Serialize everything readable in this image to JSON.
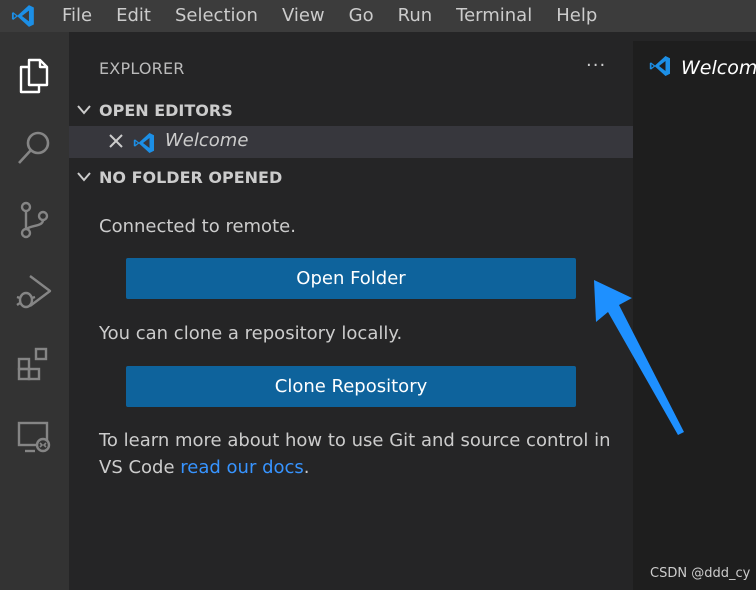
{
  "menubar": {
    "items": [
      "File",
      "Edit",
      "Selection",
      "View",
      "Go",
      "Run",
      "Terminal",
      "Help"
    ]
  },
  "activity_bar": {
    "icons": [
      "explorer-icon",
      "search-icon",
      "source-control-icon",
      "run-debug-icon",
      "extensions-icon",
      "remote-explorer-icon"
    ]
  },
  "sidebar": {
    "title": "EXPLORER",
    "more_actions": "···",
    "open_editors": {
      "header": "OPEN EDITORS",
      "items": [
        {
          "label": "Welcome"
        }
      ]
    },
    "no_folder": {
      "header": "NO FOLDER OPENED",
      "connected_text": "Connected to remote.",
      "open_folder_label": "Open Folder",
      "clone_text": "You can clone a repository locally.",
      "clone_label": "Clone Repository",
      "learn_line1": "To learn more about how to use Git and source control in",
      "learn_line2_prefix": "VS Code ",
      "learn_link": "read our docs",
      "learn_suffix": "."
    }
  },
  "editor": {
    "tab_label": "Welcome"
  },
  "watermark": "CSDN @ddd_cy",
  "colors": {
    "accent_button": "#0e639c",
    "link": "#3794ff",
    "arrow": "#1e90ff",
    "vscode_blue": "#1c8fe6"
  }
}
